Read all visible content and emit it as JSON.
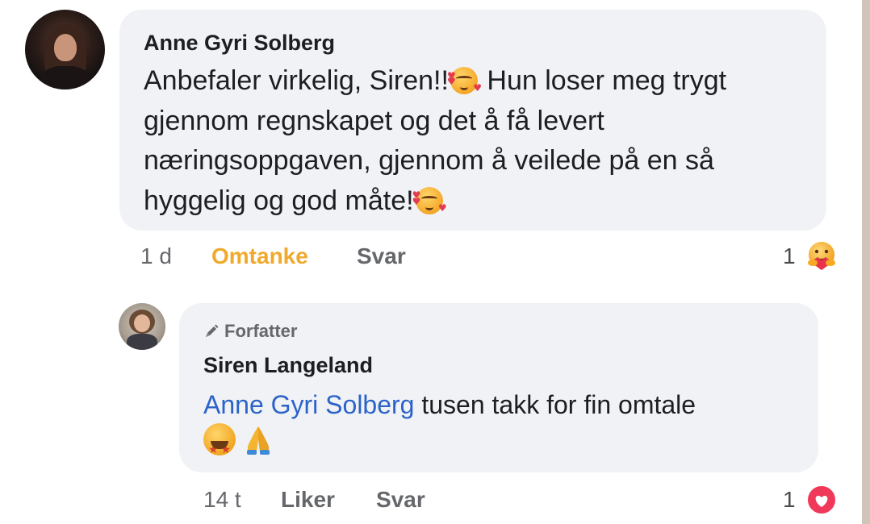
{
  "comment": {
    "author": "Anne Gyri Solberg",
    "text_part1": "Anbefaler virkelig, Siren!!",
    "text_part2": "Hun loser meg trygt gjennom regnskapet og det å få levert næringsoppgaven, gjennom å veilede på en så hyggelig og god måte!",
    "time": "1 d",
    "reaction_label": "Omtanke",
    "reply_label": "Svar",
    "reaction_count": "1",
    "reaction_icon": "care-emoji-icon",
    "accent_color": "#f0a92b"
  },
  "reply": {
    "author_tag": "Forfatter",
    "author": "Siren Langeland",
    "mention": "Anne Gyri Solberg",
    "text": "tusen takk for fin omtale",
    "time": "14 t",
    "like_label": "Liker",
    "reply_label": "Svar",
    "reaction_count": "1",
    "reaction_icon": "love-heart-icon",
    "mention_color": "#2c63c9"
  }
}
